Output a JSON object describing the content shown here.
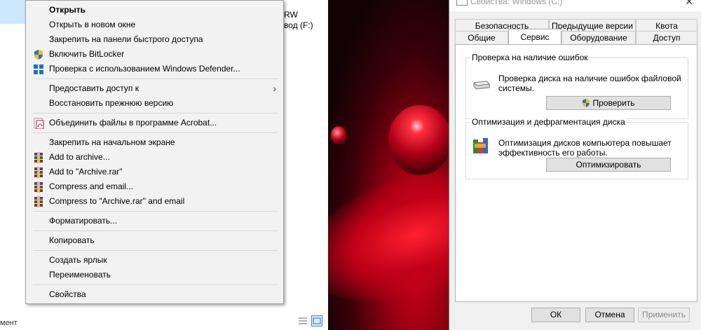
{
  "explorer": {
    "drive_text_1": "RW",
    "drive_text_2": "вод (F:)",
    "status_left": "мент"
  },
  "context_menu": {
    "items": [
      {
        "label": "Открыть",
        "bold": true
      },
      {
        "label": "Открыть в новом окне"
      },
      {
        "label": "Закрепить на панели быстрого доступа"
      },
      {
        "label": "Включить BitLocker",
        "icon": "shield-icon"
      },
      {
        "label": "Проверка с использованием Windows Defender...",
        "icon": "defender-icon"
      },
      {
        "label": "Предоставить доступ к",
        "submenu": true
      },
      {
        "label": "Восстановить прежнюю версию"
      },
      {
        "label": "Объединить файлы в программе Acrobat...",
        "icon": "acrobat-icon"
      },
      {
        "label": "Закрепить на начальном экране"
      },
      {
        "label": "Add to archive...",
        "icon": "winrar-icon"
      },
      {
        "label": "Add to \"Archive.rar\"",
        "icon": "winrar-icon"
      },
      {
        "label": "Compress and email...",
        "icon": "winrar-icon"
      },
      {
        "label": "Compress to \"Archive.rar\" and email",
        "icon": "winrar-icon"
      },
      {
        "label": "Форматировать..."
      },
      {
        "label": "Копировать"
      },
      {
        "label": "Создать ярлык"
      },
      {
        "label": "Переименовать"
      },
      {
        "label": "Свойства"
      }
    ]
  },
  "dialog": {
    "title": "Свойства: Windows (C:)",
    "close_glyph": "✕",
    "tabs_row1": [
      "Безопасность",
      "Предыдущие версии",
      "Квота"
    ],
    "tabs_row2": [
      "Общие",
      "Сервис",
      "Оборудование",
      "Доступ"
    ],
    "active_tab": "Сервис",
    "error_check": {
      "title": "Проверка на наличие ошибок",
      "description": "Проверка диска на наличие ошибок файловой системы.",
      "button": "Проверить"
    },
    "optimize": {
      "title": "Оптимизация и дефрагментация диска",
      "description": "Оптимизация дисков компьютера повышает эффективность его работы.",
      "button": "Оптимизировать"
    },
    "ok": "ОК",
    "cancel": "Отмена",
    "apply": "Применить"
  },
  "colors": {
    "menu_bg": "#f2f2f2",
    "selection": "#cce8ff",
    "wallpaper_red": "#d00018"
  }
}
